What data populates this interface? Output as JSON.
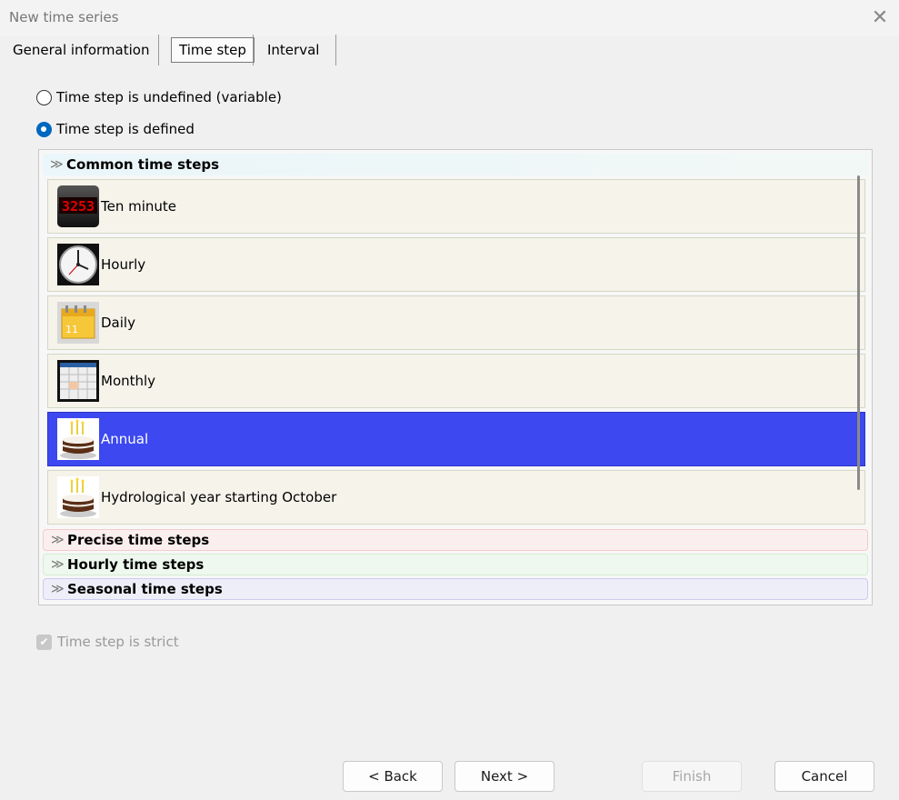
{
  "window": {
    "title": "New time series",
    "close_glyph": "✕"
  },
  "tabs": [
    {
      "label": "General information",
      "active": false
    },
    {
      "label": "Time step",
      "active": true
    },
    {
      "label": "Interval",
      "active": false
    }
  ],
  "time_step_mode": {
    "undefined_label": "Time step is undefined (variable)",
    "defined_label": "Time step is defined",
    "selected": "defined"
  },
  "groups": {
    "common": {
      "label": "Common time steps",
      "expanded": true,
      "items": [
        {
          "label": "Ten minute",
          "icon": "digital-clock-icon",
          "icon_text": "3253"
        },
        {
          "label": "Hourly",
          "icon": "clock-icon"
        },
        {
          "label": "Daily",
          "icon": "calendar-day-icon",
          "icon_text": "11"
        },
        {
          "label": "Monthly",
          "icon": "calendar-month-icon"
        },
        {
          "label": "Annual",
          "icon": "birthday-cake-icon",
          "selected": true
        },
        {
          "label": "Hydrological year starting October",
          "icon": "birthday-cake-icon"
        }
      ]
    },
    "precise": {
      "label": "Precise time steps",
      "expanded": false
    },
    "hourly": {
      "label": "Hourly time steps",
      "expanded": false
    },
    "seasonal": {
      "label": "Seasonal time steps",
      "expanded": false
    }
  },
  "strict": {
    "label": "Time step is strict",
    "checked": true,
    "disabled": true
  },
  "buttons": {
    "back": "< Back",
    "next": "Next >",
    "finish": "Finish",
    "cancel": "Cancel"
  },
  "colors": {
    "selection": "#3d48f0",
    "item_bg": "#f5f3ea",
    "radio_accent": "#0067c0"
  }
}
